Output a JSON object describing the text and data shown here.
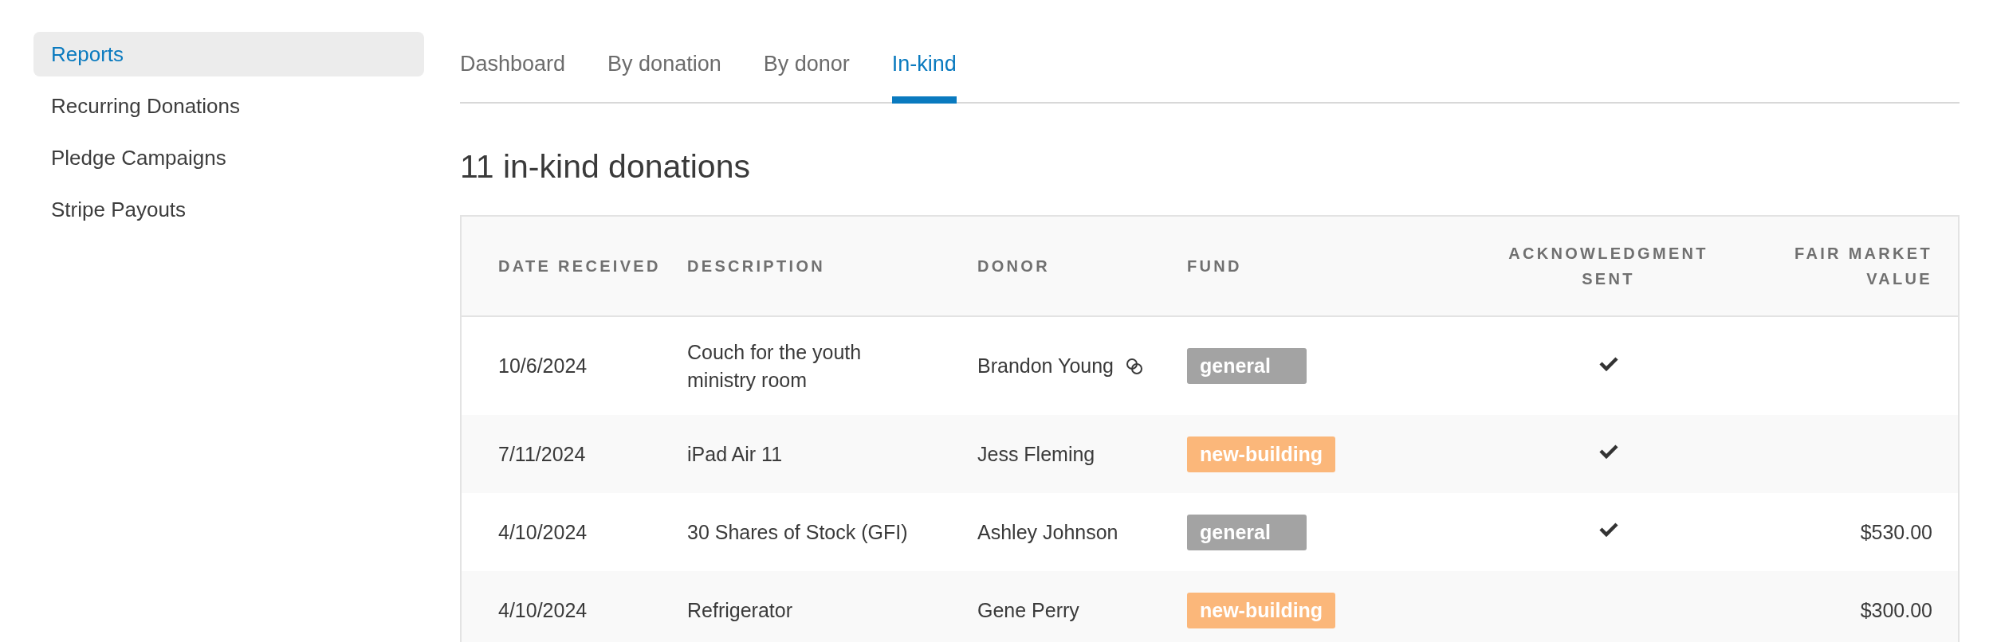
{
  "sidebar": {
    "items": [
      {
        "label": "Reports",
        "selected": true
      },
      {
        "label": "Recurring Donations",
        "selected": false
      },
      {
        "label": "Pledge Campaigns",
        "selected": false
      },
      {
        "label": "Stripe Payouts",
        "selected": false
      }
    ]
  },
  "tabs": [
    {
      "label": "Dashboard",
      "selected": false
    },
    {
      "label": "By donation",
      "selected": false
    },
    {
      "label": "By donor",
      "selected": false
    },
    {
      "label": "In-kind",
      "selected": true
    }
  ],
  "title": "11 in-kind donations",
  "table": {
    "columns": [
      "DATE RECEIVED",
      "DESCRIPTION",
      "DONOR",
      "FUND",
      "ACKNOWLEDGMENT SENT",
      "FAIR MARKET VALUE"
    ],
    "rows": [
      {
        "date": "10/6/2024",
        "description": "Couch for the youth ministry room",
        "donor": "Brandon Young",
        "linked": true,
        "fund": {
          "label": "general",
          "color": "#a3a3a3"
        },
        "acknowledged": true
      },
      {
        "date": "7/11/2024",
        "description": "iPad Air 11",
        "donor": "Jess Fleming",
        "linked": false,
        "fund": {
          "label": "new-building",
          "color": "#fbb77a"
        },
        "acknowledged": true
      },
      {
        "date": "4/10/2024",
        "description": "30 Shares of Stock (GFI)",
        "donor": "Ashley Johnson",
        "linked": false,
        "fund": {
          "label": "general",
          "color": "#a3a3a3"
        },
        "acknowledged": true,
        "value": "$530.00"
      },
      {
        "date": "4/10/2024",
        "description": "Refrigerator",
        "donor": "Gene Perry",
        "linked": false,
        "fund": {
          "label": "new-building",
          "color": "#fbb77a"
        },
        "acknowledged": false,
        "value": "$300.00"
      }
    ]
  }
}
